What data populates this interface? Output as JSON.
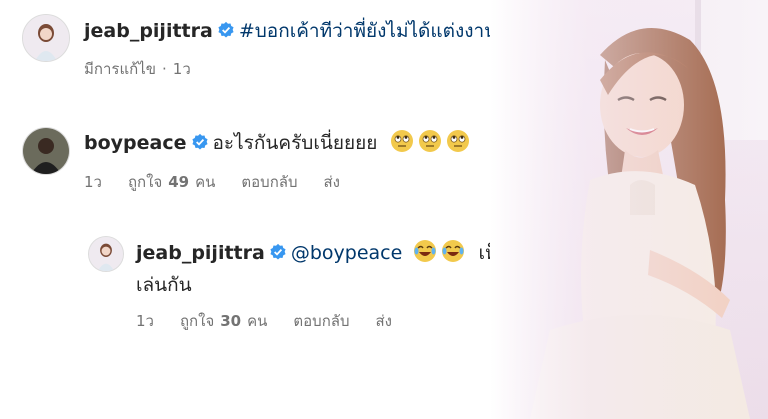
{
  "caption": {
    "username": "jeab_pijittra",
    "hashtag": "#บอกเค้าทีว่าพี่ยังไม่ได้แต่งงาน",
    "edited_label": "มีการแก้ไข",
    "time": "1ว"
  },
  "comment": {
    "username": "boypeace",
    "text": "อะไรกันครับเนี่ยยยย",
    "emojis": [
      "face-with-rolling-eyes-icon",
      "face-with-rolling-eyes-icon",
      "face-with-rolling-eyes-icon"
    ],
    "time": "1ว",
    "likes_label": "ถูกใจ",
    "likes_count": "49",
    "likes_unit": "คน",
    "reply_label": "ตอบกลับ",
    "send_label": "ส่ง"
  },
  "reply": {
    "username": "jeab_pijittra",
    "mention": "@boypeace",
    "emojis": [
      "face-with-tears-of-joy-icon",
      "face-with-tears-of-joy-icon"
    ],
    "text_tail": "เห็นเค้า",
    "text_line2": "เล่นกัน",
    "time": "1ว",
    "likes_label": "ถูกใจ",
    "likes_count": "30",
    "likes_unit": "คน",
    "reply_label": "ตอบกลับ",
    "send_label": "ส่ง"
  },
  "colors": {
    "verified_blue": "#3897f0",
    "link_blue": "#00376b",
    "meta_gray": "#737373"
  }
}
